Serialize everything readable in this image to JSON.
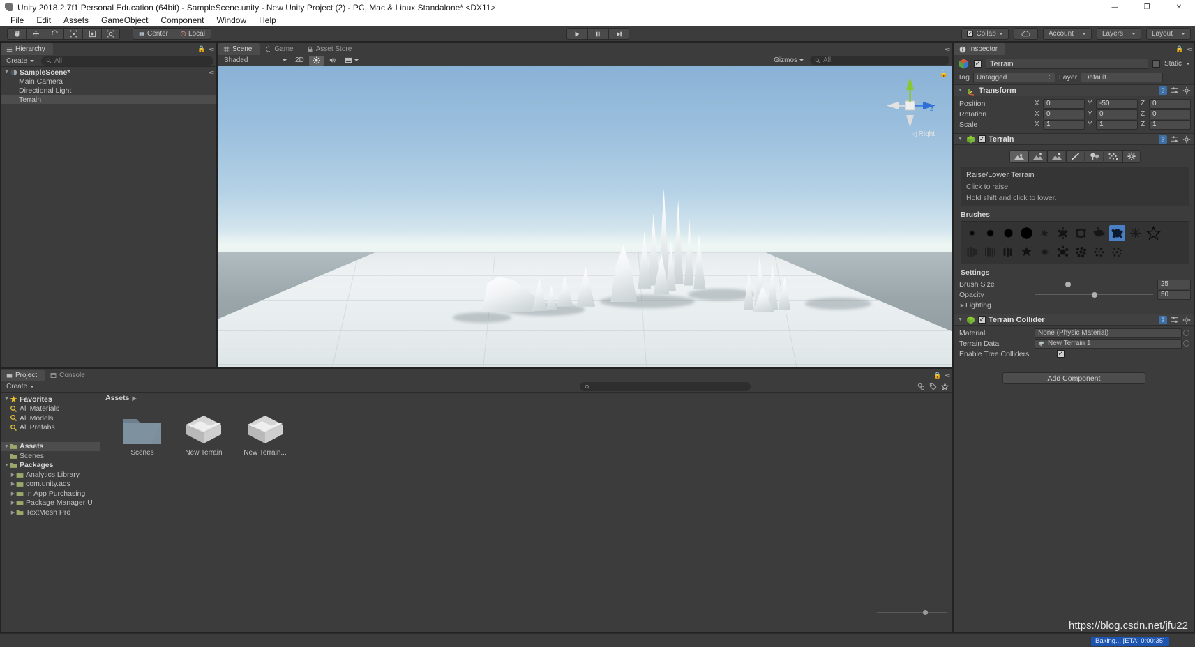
{
  "window": {
    "title": "Unity 2018.2.7f1 Personal Education (64bit) - SampleScene.unity - New Unity Project (2) - PC, Mac & Linux Standalone* <DX11>",
    "minimize": "—",
    "maximize": "❐",
    "close": "✕"
  },
  "menubar": {
    "items": [
      "File",
      "Edit",
      "Assets",
      "GameObject",
      "Component",
      "Window",
      "Help"
    ]
  },
  "toolbar": {
    "transform_tools": [
      "hand-tool",
      "move-tool",
      "rotate-tool",
      "scale-tool",
      "rect-tool",
      "transform-tool"
    ],
    "pivot_mode": "Center",
    "pivot_rotation": "Local",
    "play": "play-icon",
    "pause": "pause-icon",
    "step": "step-icon",
    "collab": "Collab",
    "cloud": "cloud-icon",
    "account": "Account",
    "layers": "Layers",
    "layout": "Layout"
  },
  "hierarchy": {
    "tab": "Hierarchy",
    "create": "Create",
    "search_placeholder": "All",
    "items": [
      {
        "label": "SampleScene*",
        "type": "scene",
        "depth": 0,
        "selected": false
      },
      {
        "label": "Main Camera",
        "type": "gameobject",
        "depth": 1,
        "selected": false
      },
      {
        "label": "Directional Light",
        "type": "gameobject",
        "depth": 1,
        "selected": false
      },
      {
        "label": "Terrain",
        "type": "gameobject",
        "depth": 1,
        "selected": true
      }
    ]
  },
  "sceneview": {
    "tabs": [
      {
        "label": "Scene",
        "active": true
      },
      {
        "label": "Game",
        "active": false
      },
      {
        "label": "Asset Store",
        "active": false
      }
    ],
    "draw_mode": "Shaded",
    "two_d": "2D",
    "lighting": "lighting-icon",
    "audio": "audio-icon",
    "fx": "effects-icon",
    "gizmos": "Gizmos",
    "search_placeholder": "All",
    "gizmo_axes": {
      "x": "x",
      "y": "y",
      "z": "z"
    },
    "gizmo_view_label": "Right"
  },
  "project": {
    "tabs": [
      {
        "label": "Project",
        "active": true
      },
      {
        "label": "Console",
        "active": false
      }
    ],
    "create": "Create",
    "search_placeholder": "",
    "breadcrumb": "Assets",
    "tree": [
      {
        "label": "Favorites",
        "depth": 0,
        "icon": "star-icon",
        "bold": true,
        "arrow": "down"
      },
      {
        "label": "All Materials",
        "depth": 1,
        "icon": "search-icon",
        "bold": false,
        "arrow": ""
      },
      {
        "label": "All Models",
        "depth": 1,
        "icon": "search-icon",
        "bold": false,
        "arrow": ""
      },
      {
        "label": "All Prefabs",
        "depth": 1,
        "icon": "search-icon",
        "bold": false,
        "arrow": ""
      },
      {
        "label": "",
        "depth": 0,
        "icon": "",
        "bold": false,
        "arrow": ""
      },
      {
        "label": "Assets",
        "depth": 0,
        "icon": "folder-icon",
        "bold": true,
        "arrow": "down",
        "selected": true
      },
      {
        "label": "Scenes",
        "depth": 1,
        "icon": "folder-icon",
        "bold": false,
        "arrow": ""
      },
      {
        "label": "Packages",
        "depth": 0,
        "icon": "folder-icon",
        "bold": true,
        "arrow": "down"
      },
      {
        "label": "Analytics Library",
        "depth": 1,
        "icon": "folder-icon",
        "bold": false,
        "arrow": "right"
      },
      {
        "label": "com.unity.ads",
        "depth": 1,
        "icon": "folder-icon",
        "bold": false,
        "arrow": "right"
      },
      {
        "label": "In App Purchasing",
        "depth": 1,
        "icon": "folder-icon",
        "bold": false,
        "arrow": "right"
      },
      {
        "label": "Package Manager U",
        "depth": 1,
        "icon": "folder-icon",
        "bold": false,
        "arrow": "right"
      },
      {
        "label": "TextMesh Pro",
        "depth": 1,
        "icon": "folder-icon",
        "bold": false,
        "arrow": "right"
      }
    ],
    "assets": [
      {
        "label": "Scenes",
        "icon": "folder-asset-icon"
      },
      {
        "label": "New Terrain",
        "icon": "terrain-asset-icon"
      },
      {
        "label": "New Terrain...",
        "icon": "terrain-asset-icon"
      }
    ]
  },
  "inspector": {
    "tab": "Inspector",
    "object_name": "Terrain",
    "object_enabled": true,
    "static_label": "Static",
    "tag_label": "Tag",
    "tag_value": "Untagged",
    "layer_label": "Layer",
    "layer_value": "Default",
    "transform": {
      "title": "Transform",
      "rows": [
        {
          "label": "Position",
          "x": "0",
          "y": "-50",
          "z": "0"
        },
        {
          "label": "Rotation",
          "x": "0",
          "y": "0",
          "z": "0"
        },
        {
          "label": "Scale",
          "x": "1",
          "y": "1",
          "z": "1"
        }
      ],
      "axes": [
        "X",
        "Y",
        "Z"
      ]
    },
    "terrain": {
      "title": "Terrain",
      "enabled": true,
      "tools": [
        {
          "name": "raise-lower-terrain-tool",
          "active": true
        },
        {
          "name": "set-height-tool",
          "active": false
        },
        {
          "name": "smooth-height-tool",
          "active": false
        },
        {
          "name": "paint-texture-tool",
          "active": false
        },
        {
          "name": "place-trees-tool",
          "active": false
        },
        {
          "name": "paint-details-tool",
          "active": false
        },
        {
          "name": "terrain-settings-tool",
          "active": false
        }
      ],
      "help_title": "Raise/Lower Terrain",
      "help_lines": [
        "Click to raise.",
        "Hold shift and click to lower."
      ],
      "brushes_label": "Brushes",
      "brush_selected_index": 8,
      "settings_label": "Settings",
      "brush_size_label": "Brush Size",
      "brush_size_value": "25",
      "opacity_label": "Opacity",
      "opacity_value": "50",
      "lighting_label": "Lighting"
    },
    "terrain_collider": {
      "title": "Terrain Collider",
      "enabled": true,
      "material_label": "Material",
      "material_value": "None (Physic Material)",
      "terrain_data_label": "Terrain Data",
      "terrain_data_value": "New Terrain 1",
      "tree_colliders_label": "Enable Tree Colliders",
      "tree_colliders_checked": true
    },
    "add_component": "Add Component"
  },
  "statusbar": {
    "baking": "Baking... [ETA: 0:00:35]"
  },
  "watermark": "https://blog.csdn.net/jfu22",
  "colors": {
    "panel_bg": "#3c3c3c",
    "panel_border": "#232323",
    "selection": "#4d4d4d",
    "brush_select": "#4b7fc4",
    "baking_blue": "#1c54b2",
    "sky_top": "#8ab2d6",
    "terrain_white": "#f2f5f6"
  }
}
